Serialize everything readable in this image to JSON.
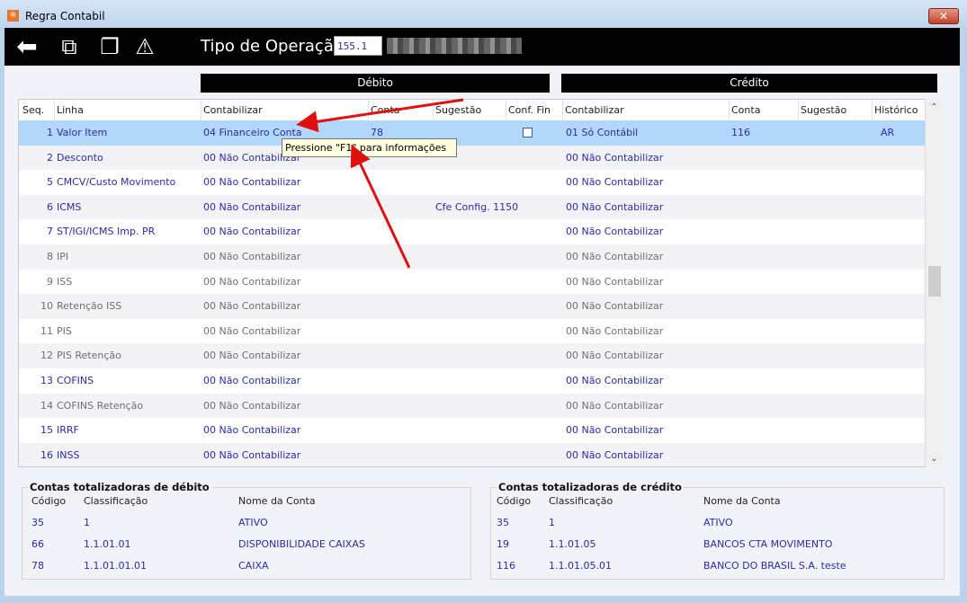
{
  "window": {
    "title": "Regra Contabil",
    "close": "✕"
  },
  "toolbar": {
    "icons": [
      "back-arrow-icon",
      "export-icon",
      "copy-icon",
      "warning-icon"
    ],
    "operation_label": "Tipo de Operação",
    "operation_value": "155.1"
  },
  "sections": {
    "debit": "Débito",
    "credit": "Crédito"
  },
  "grid": {
    "headers": [
      "Seq.",
      "Linha",
      "Contabilizar",
      "Conta",
      "Sugestão",
      "Conf. Fin",
      "Contabilizar",
      "Conta",
      "Sugestão",
      "Histórico"
    ],
    "rows": [
      {
        "seq": "1",
        "linha": "Valor Item",
        "d_contab": "04 Financeiro Conta",
        "d_conta": "78",
        "d_sug": "",
        "conf_fin": false,
        "c_contab": "01 Só Contábil",
        "c_conta": "116",
        "c_sug": "",
        "hist": "AR",
        "enabled": true,
        "selected": true
      },
      {
        "seq": "2",
        "linha": "Desconto",
        "d_contab": "00 Não Contabilizar",
        "d_conta": "",
        "d_sug": "",
        "c_contab": "00 Não Contabilizar",
        "c_conta": "",
        "c_sug": "",
        "hist": "",
        "enabled": true
      },
      {
        "seq": "5",
        "linha": "CMCV/Custo Movimento",
        "d_contab": "00 Não Contabilizar",
        "d_conta": "",
        "d_sug": "",
        "c_contab": "00 Não Contabilizar",
        "c_conta": "",
        "c_sug": "",
        "hist": "",
        "enabled": true
      },
      {
        "seq": "6",
        "linha": "ICMS",
        "d_contab": "00 Não Contabilizar",
        "d_conta": "",
        "d_sug": "Cfe Config. 1150",
        "c_contab": "00 Não Contabilizar",
        "c_conta": "",
        "c_sug": "",
        "hist": "",
        "enabled": true
      },
      {
        "seq": "7",
        "linha": "ST/IGI/ICMS Imp. PR",
        "d_contab": "00 Não Contabilizar",
        "d_conta": "",
        "d_sug": "",
        "c_contab": "00 Não Contabilizar",
        "c_conta": "",
        "c_sug": "",
        "hist": "",
        "enabled": true
      },
      {
        "seq": "8",
        "linha": "IPI",
        "d_contab": "00 Não Contabilizar",
        "d_conta": "",
        "d_sug": "",
        "c_contab": "00 Não Contabilizar",
        "c_conta": "",
        "c_sug": "",
        "hist": "",
        "enabled": false
      },
      {
        "seq": "9",
        "linha": "ISS",
        "d_contab": "00 Não Contabilizar",
        "d_conta": "",
        "d_sug": "",
        "c_contab": "00 Não Contabilizar",
        "c_conta": "",
        "c_sug": "",
        "hist": "",
        "enabled": false
      },
      {
        "seq": "10",
        "linha": "Retenção ISS",
        "d_contab": "00 Não Contabilizar",
        "d_conta": "",
        "d_sug": "",
        "c_contab": "00 Não Contabilizar",
        "c_conta": "",
        "c_sug": "",
        "hist": "",
        "enabled": false
      },
      {
        "seq": "11",
        "linha": "PIS",
        "d_contab": "00 Não Contabilizar",
        "d_conta": "",
        "d_sug": "",
        "c_contab": "00 Não Contabilizar",
        "c_conta": "",
        "c_sug": "",
        "hist": "",
        "enabled": false
      },
      {
        "seq": "12",
        "linha": "PIS Retenção",
        "d_contab": "00 Não Contabilizar",
        "d_conta": "",
        "d_sug": "",
        "c_contab": "00 Não Contabilizar",
        "c_conta": "",
        "c_sug": "",
        "hist": "",
        "enabled": false
      },
      {
        "seq": "13",
        "linha": "COFINS",
        "d_contab": "00 Não Contabilizar",
        "d_conta": "",
        "d_sug": "",
        "c_contab": "00 Não Contabilizar",
        "c_conta": "",
        "c_sug": "",
        "hist": "",
        "enabled": true
      },
      {
        "seq": "14",
        "linha": "COFINS Retenção",
        "d_contab": "00 Não Contabilizar",
        "d_conta": "",
        "d_sug": "",
        "c_contab": "00 Não Contabilizar",
        "c_conta": "",
        "c_sug": "",
        "hist": "",
        "enabled": false
      },
      {
        "seq": "15",
        "linha": "IRRF",
        "d_contab": "00 Não Contabilizar",
        "d_conta": "",
        "d_sug": "",
        "c_contab": "00 Não Contabilizar",
        "c_conta": "",
        "c_sug": "",
        "hist": "",
        "enabled": true
      },
      {
        "seq": "16",
        "linha": "INSS",
        "d_contab": "00 Não Contabilizar",
        "d_conta": "",
        "d_sug": "",
        "c_contab": "00 Não Contabilizar",
        "c_conta": "",
        "c_sug": "",
        "hist": "",
        "enabled": true
      }
    ]
  },
  "tooltip": "Pressione \"F1\" para informações",
  "debit_totals": {
    "title": "Contas totalizadoras de débito",
    "headers": [
      "Código",
      "Classificação",
      "Nome da Conta"
    ],
    "rows": [
      [
        "35",
        "1",
        "ATIVO"
      ],
      [
        "66",
        "1.1.01.01",
        "DISPONIBILIDADE CAIXAS"
      ],
      [
        "78",
        "1.1.01.01.01",
        "CAIXA"
      ]
    ]
  },
  "credit_totals": {
    "title": "Contas totalizadoras de crédito",
    "headers": [
      "Código",
      "Classificação",
      "Nome da Conta"
    ],
    "rows": [
      [
        "35",
        "1",
        "ATIVO"
      ],
      [
        "19",
        "1.1.01.05",
        "BANCOS CTA MOVIMENTO"
      ],
      [
        "116",
        "1.1.01.05.01",
        "BANCO DO BRASIL S.A. teste"
      ]
    ]
  },
  "colors": {
    "selected_row": "#b3d7fb",
    "enabled_text": "#2b2ba8",
    "disabled_text": "#707070",
    "annotation_arrow": "#e01010"
  }
}
